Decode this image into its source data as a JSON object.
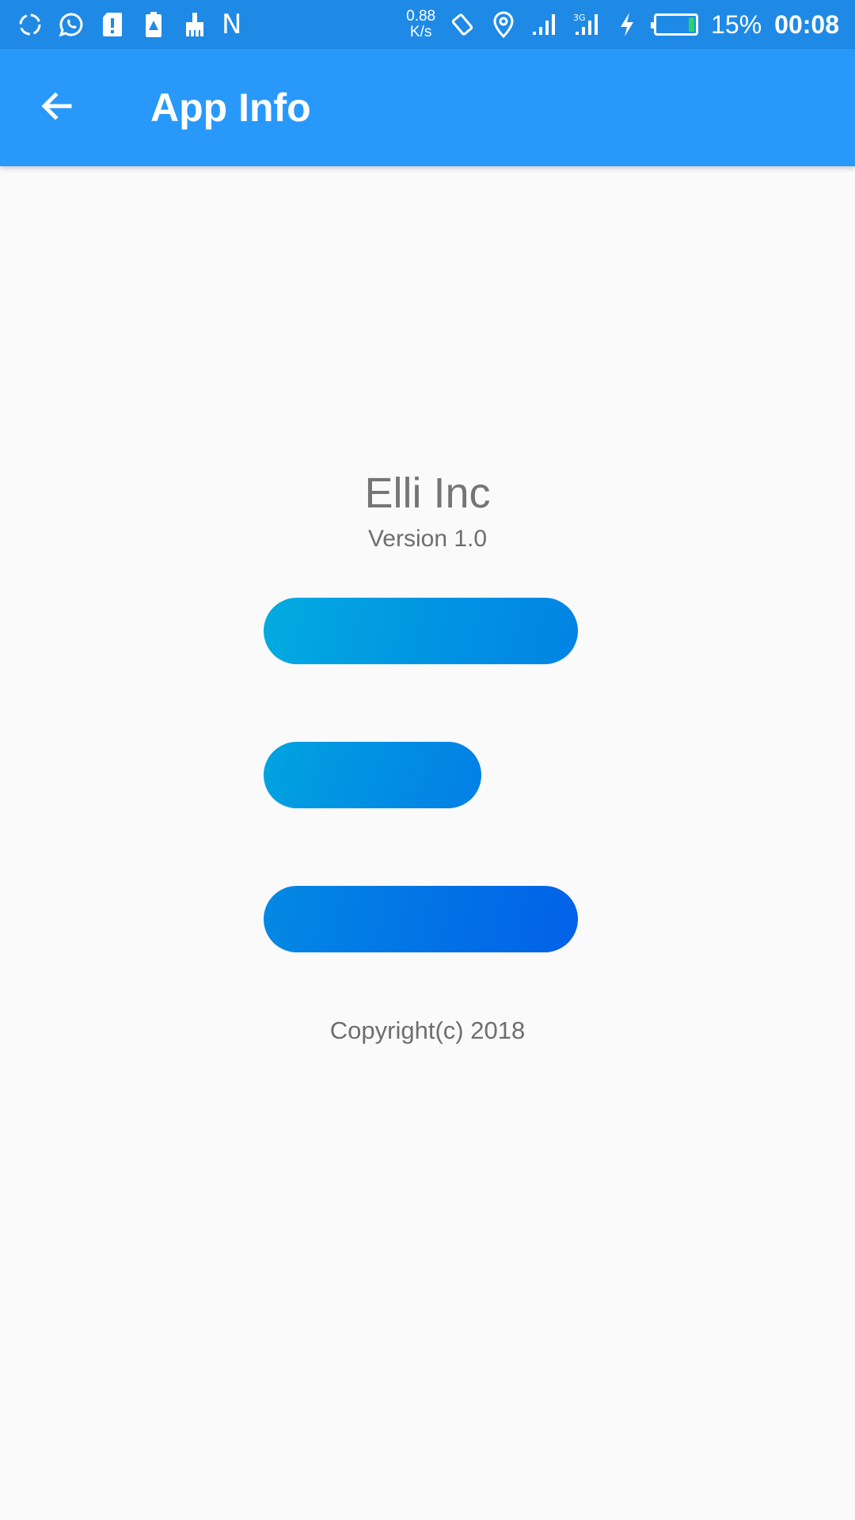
{
  "status_bar": {
    "left_icons": [
      "sync-icon",
      "whatsapp-icon",
      "sd-card-alert-icon",
      "battery-alert-icon",
      "cleaner-brush-icon"
    ],
    "n_glyph": "N",
    "net_speed_value": "0.88",
    "net_speed_unit": "K/s",
    "right_icons": [
      "rotate-icon",
      "location-icon",
      "signal-icon",
      "signal-3g-icon",
      "charging-icon"
    ],
    "battery_percent": "15%",
    "battery_level": 0.15,
    "time": "00:08"
  },
  "app_bar": {
    "back_icon": "arrow-left-icon",
    "title": "App Info",
    "color": "#2899fa"
  },
  "content": {
    "company_name": "Elli Inc",
    "version": "Version 1.0",
    "buttons": [
      {
        "label": ""
      },
      {
        "label": ""
      },
      {
        "label": ""
      }
    ],
    "copyright": "Copyright(c) 2018"
  },
  "colors": {
    "status_bar": "#1f8ae6",
    "background": "#fafafa",
    "text_gray": "#757575",
    "button_gradient_start": "#02abe0",
    "button_gradient_end": "#0261e8"
  }
}
